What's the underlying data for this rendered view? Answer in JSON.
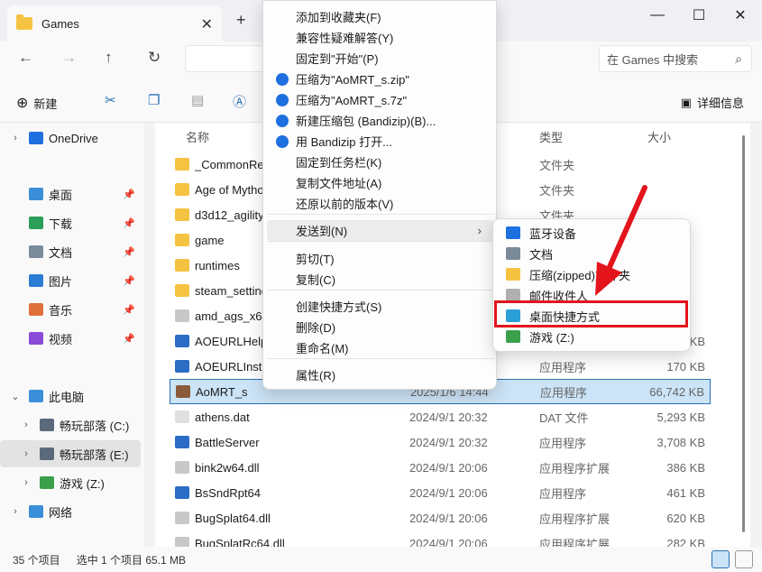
{
  "window": {
    "tab_title": "Games",
    "new_tab_glyph": "+",
    "minimize_glyph": "—",
    "maximize_glyph": "☐",
    "close_glyph": "✕"
  },
  "nav": {
    "back_glyph": "←",
    "forward_glyph": "→",
    "up_glyph": "↑",
    "refresh_glyph": "↻",
    "search_placeholder": "在 Games 中搜索",
    "search_glyph": "⌕"
  },
  "toolbar": {
    "new_label": "新建",
    "new_glyph": "⊕",
    "details_label": "详细信息",
    "details_glyph": "▣"
  },
  "sidebar": {
    "items": [
      {
        "label": "OneDrive",
        "icon": "cloud-icon",
        "color": "#1e6fe0"
      },
      {
        "label": "桌面",
        "icon": "desktop-icon",
        "color": "#3a8fd8"
      },
      {
        "label": "下载",
        "icon": "download-icon",
        "color": "#2b9e5a"
      },
      {
        "label": "文档",
        "icon": "document-icon",
        "color": "#7a8a99"
      },
      {
        "label": "图片",
        "icon": "picture-icon",
        "color": "#2b7cd3"
      },
      {
        "label": "音乐",
        "icon": "music-icon",
        "color": "#e0703a"
      },
      {
        "label": "视频",
        "icon": "video-icon",
        "color": "#8a4bd6"
      },
      {
        "label": "此电脑",
        "icon": "pc-icon",
        "color": "#3a8fd8"
      },
      {
        "label": "畅玩部落 (C:)",
        "icon": "drive-icon",
        "color": "#5a6a7a"
      },
      {
        "label": "畅玩部落 (E:)",
        "icon": "drive-icon",
        "color": "#5a6a7a"
      },
      {
        "label": "游戏 (Z:)",
        "icon": "drive-icon",
        "color": "#3aa04a"
      },
      {
        "label": "网络",
        "icon": "network-icon",
        "color": "#3a8fd8"
      }
    ]
  },
  "columns": {
    "name": "名称",
    "type": "类型",
    "size": "大小"
  },
  "files": [
    {
      "name": "_CommonRedist",
      "date": "",
      "type": "文件夹",
      "size": "",
      "kind": "folder"
    },
    {
      "name": "Age of Mythology",
      "date": "",
      "type": "文件夹",
      "size": "",
      "kind": "folder"
    },
    {
      "name": "d3d12_agility",
      "date": "",
      "type": "文件夹",
      "size": "",
      "kind": "folder"
    },
    {
      "name": "game",
      "date": "",
      "type": "",
      "size": "",
      "kind": "folder"
    },
    {
      "name": "runtimes",
      "date": "",
      "type": "",
      "size": "",
      "kind": "folder"
    },
    {
      "name": "steam_settings",
      "date": "",
      "type": "",
      "size": "",
      "kind": "folder"
    },
    {
      "name": "amd_ags_x64",
      "date": "",
      "type": "",
      "size": "",
      "kind": "dll"
    },
    {
      "name": "AOEURLHelper",
      "date": "",
      "type": "",
      "size": "KB",
      "kind": "app"
    },
    {
      "name": "AOEURLInstaller",
      "date": "",
      "type": "应用程序",
      "size": "170 KB",
      "kind": "app"
    },
    {
      "name": "AoMRT_s",
      "date": "2025/1/6 14:44",
      "type": "应用程序",
      "size": "66,742 KB",
      "kind": "game"
    },
    {
      "name": "athens.dat",
      "date": "2024/9/1 20:32",
      "type": "DAT 文件",
      "size": "5,293 KB",
      "kind": "file"
    },
    {
      "name": "BattleServer",
      "date": "2024/9/1 20:32",
      "type": "应用程序",
      "size": "3,708 KB",
      "kind": "app"
    },
    {
      "name": "bink2w64.dll",
      "date": "2024/9/1 20:06",
      "type": "应用程序扩展",
      "size": "386 KB",
      "kind": "dll"
    },
    {
      "name": "BsSndRpt64",
      "date": "2024/9/1 20:06",
      "type": "应用程序",
      "size": "461 KB",
      "kind": "app"
    },
    {
      "name": "BugSplat64.dll",
      "date": "2024/9/1 20:06",
      "type": "应用程序扩展",
      "size": "620 KB",
      "kind": "dll"
    },
    {
      "name": "BugSplatRc64.dll",
      "date": "2024/9/1 20:06",
      "type": "应用程序扩展",
      "size": "282 KB",
      "kind": "dll"
    }
  ],
  "context_menu": {
    "items": [
      {
        "label": "添加到收藏夹(F)",
        "icon": ""
      },
      {
        "label": "兼容性疑难解答(Y)",
        "icon": ""
      },
      {
        "label": "固定到\"开始\"(P)",
        "icon": ""
      },
      {
        "label": "压缩为\"AoMRT_s.zip\"",
        "icon": "bandizip-icon"
      },
      {
        "label": "压缩为\"AoMRT_s.7z\"",
        "icon": "bandizip-icon"
      },
      {
        "label": "新建压缩包 (Bandizip)(B)...",
        "icon": "bandizip-icon"
      },
      {
        "label": "用 Bandizip 打开...",
        "icon": "bandizip-icon"
      },
      {
        "label": "固定到任务栏(K)",
        "icon": ""
      },
      {
        "label": "复制文件地址(A)",
        "icon": ""
      },
      {
        "label": "还原以前的版本(V)",
        "icon": ""
      },
      {
        "label": "发送到(N)",
        "icon": "",
        "submenu": true
      },
      {
        "label": "剪切(T)",
        "icon": ""
      },
      {
        "label": "复制(C)",
        "icon": ""
      },
      {
        "label": "创建快捷方式(S)",
        "icon": ""
      },
      {
        "label": "删除(D)",
        "icon": ""
      },
      {
        "label": "重命名(M)",
        "icon": ""
      },
      {
        "label": "属性(R)",
        "icon": ""
      }
    ],
    "submenu_arrow": "›"
  },
  "send_to": {
    "items": [
      {
        "label": "蓝牙设备",
        "icon": "bluetooth-icon",
        "color": "#1e6fe0"
      },
      {
        "label": "文档",
        "icon": "document-icon",
        "color": "#7a8a99"
      },
      {
        "label": "压缩(zipped)文件夹",
        "icon": "zip-folder-icon",
        "color": "#f5c341"
      },
      {
        "label": "邮件收件人",
        "icon": "mail-icon",
        "color": "#b0b0b0"
      },
      {
        "label": "桌面快捷方式",
        "icon": "desktop-shortcut-icon",
        "color": "#2aa0d8"
      },
      {
        "label": "游戏 (Z:)",
        "icon": "drive-icon",
        "color": "#3aa04a"
      }
    ]
  },
  "status": {
    "count": "35 个项目",
    "selection": "选中 1 个项目  65.1 MB"
  },
  "colors": {
    "accent": "#2a6fb6",
    "highlight": "#e3141c",
    "folder": "#f5c341"
  }
}
